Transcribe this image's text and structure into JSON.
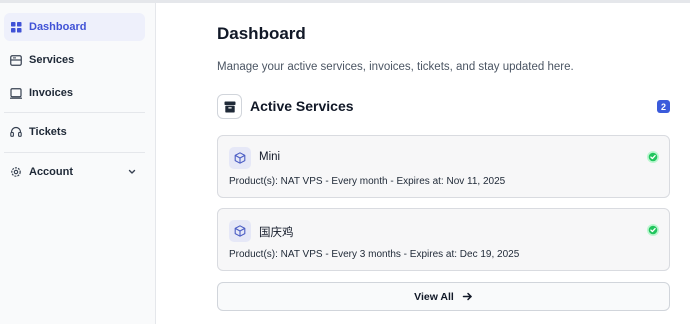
{
  "sidebar": {
    "items": [
      {
        "label": "Dashboard",
        "icon": "dashboard-grid-icon",
        "active": true
      },
      {
        "label": "Services",
        "icon": "server-icon"
      },
      {
        "label": "Invoices",
        "icon": "invoice-icon"
      },
      {
        "label": "Tickets",
        "icon": "headset-icon"
      },
      {
        "label": "Account",
        "icon": "gear-icon",
        "expandable": true
      }
    ]
  },
  "main": {
    "title": "Dashboard",
    "subtitle": "Manage your active services, invoices, tickets, and stay updated here.",
    "active_services": {
      "title": "Active Services",
      "count": "2",
      "services": [
        {
          "name": "Mini",
          "details": "Product(s): NAT VPS - Every month - Expires at: Nov 11, 2025",
          "status": "active"
        },
        {
          "name": "国庆鸡",
          "details": "Product(s): NAT VPS - Every 3 months - Expires at: Dec 19, 2025",
          "status": "active"
        }
      ],
      "view_all_label": "View All"
    }
  },
  "colors": {
    "accent": "#4052d6",
    "badge": "#3b5bdb",
    "status_ok": "#22c55e"
  }
}
